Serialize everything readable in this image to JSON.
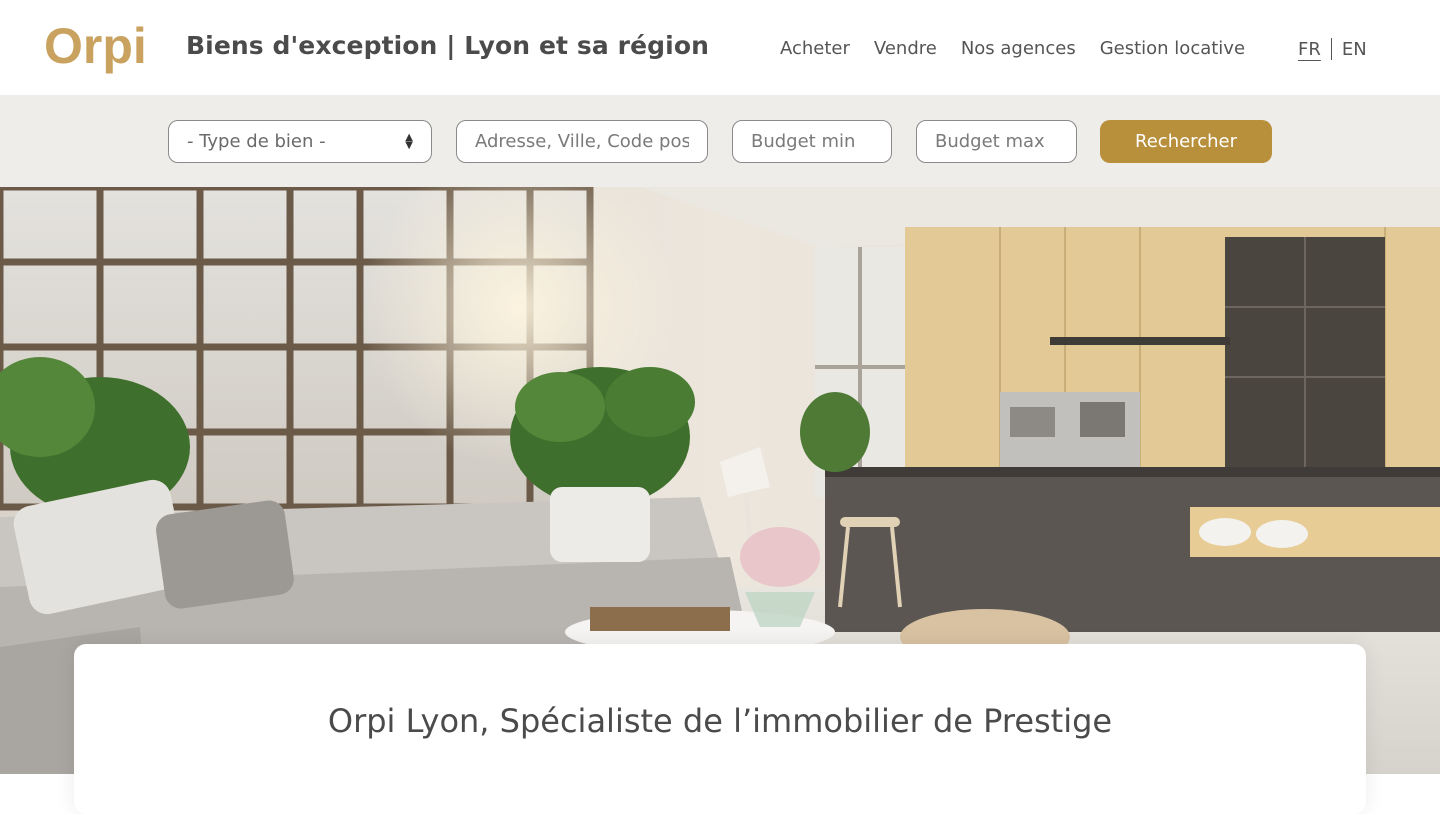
{
  "brand": {
    "logo_text": "Orpi",
    "site_title": "Biens d'exception | Lyon et sa région",
    "accent_color": "#b88f3a",
    "logo_color": "#c9a260"
  },
  "nav": {
    "items": [
      {
        "label": "Acheter"
      },
      {
        "label": "Vendre"
      },
      {
        "label": "Nos agences"
      },
      {
        "label": "Gestion locative"
      }
    ]
  },
  "lang": {
    "fr": "FR",
    "en": "EN",
    "active": "FR"
  },
  "search": {
    "type_select": "- Type de bien -",
    "address_placeholder": "Adresse, Ville, Code postal",
    "budget_min_placeholder": "Budget min",
    "budget_max_placeholder": "Budget max",
    "submit_label": "Rechercher"
  },
  "hero": {
    "image_subject": "living-room-kitchen-photo"
  },
  "card": {
    "title": "Orpi Lyon, Spécialiste de l’immobilier de Prestige"
  }
}
